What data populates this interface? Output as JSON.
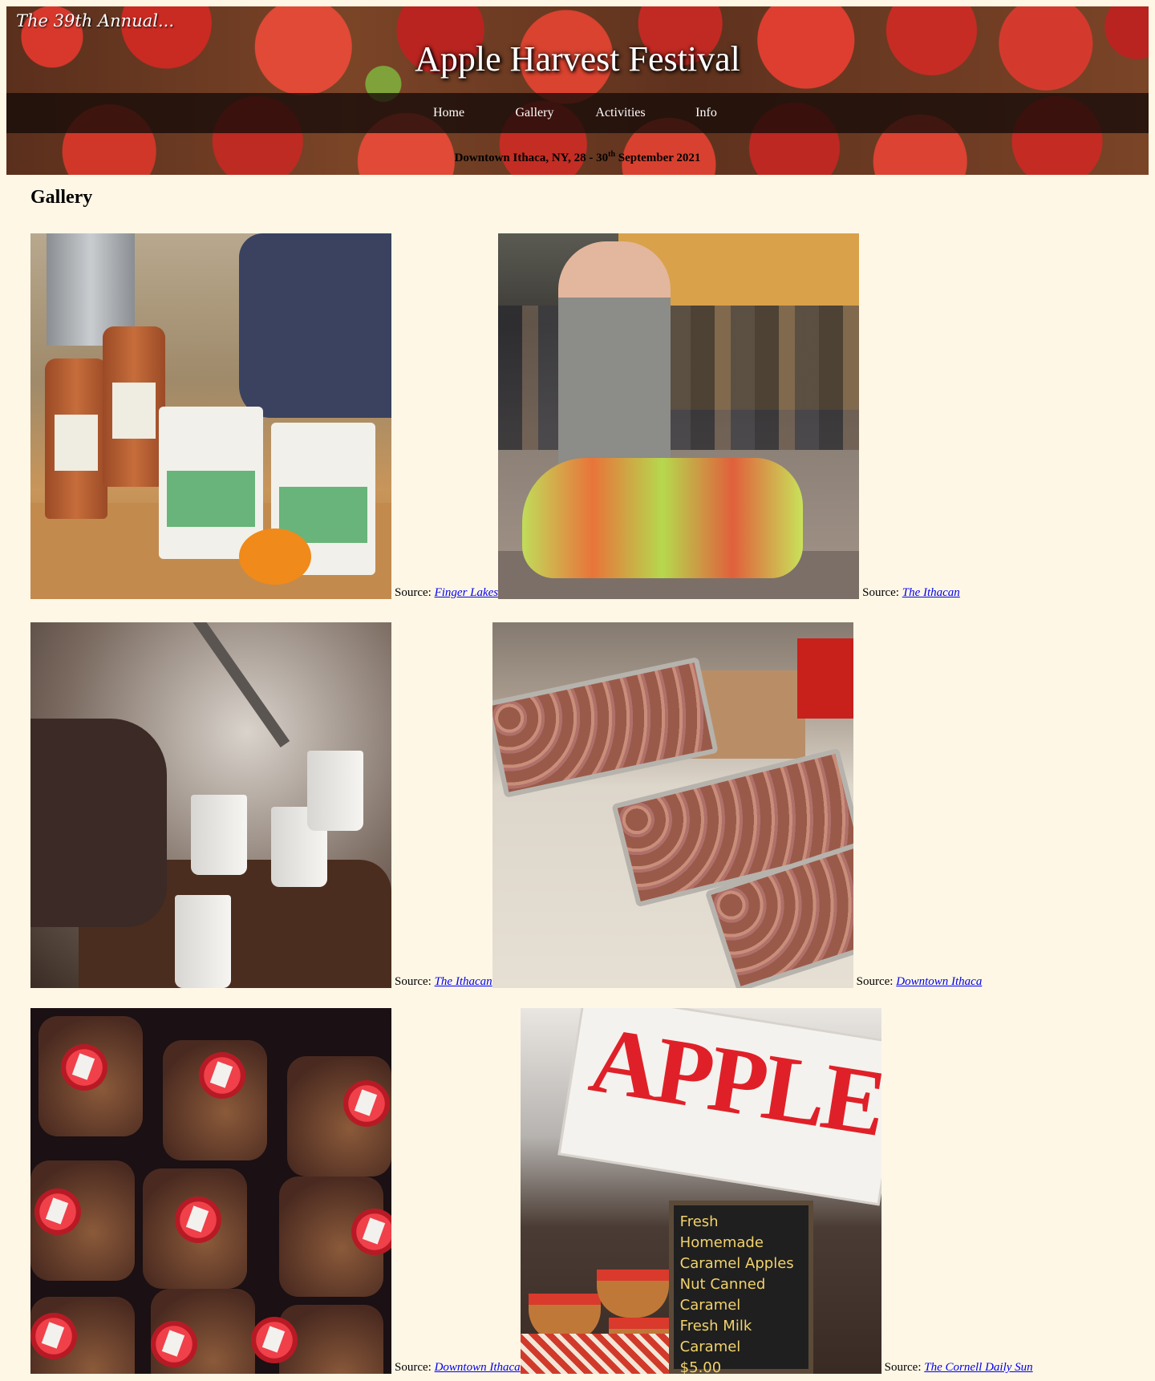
{
  "header": {
    "tagline": "The 39th Annual...",
    "title": "Apple Harvest Festival",
    "nav": [
      "Home",
      "Gallery",
      "Activities",
      "Info"
    ],
    "date_prefix": "Downtown Ithaca, NY, 28 - 30",
    "date_sup": "th",
    "date_suffix": " September 2021"
  },
  "gallery": {
    "heading": "Gallery",
    "source_label": "Source:",
    "items": [
      {
        "source": "Finger Lakes",
        "photo": "cider-jugs-and-apple-bags"
      },
      {
        "source": "The Ithacan",
        "photo": "woman-with-dyed-poodle"
      },
      {
        "source": "The Ithacan",
        "photo": "ladling-hot-cider"
      },
      {
        "source": "Downtown Ithaca",
        "photo": "trays-of-cider-donuts"
      },
      {
        "source": "Downtown Ithaca",
        "photo": "red-capped-cider-jugs"
      },
      {
        "source": "The Cornell Daily Sun",
        "photo": "apples-sign-stand"
      }
    ]
  },
  "photo_text": {
    "sign": "APPLES",
    "chalkboard": [
      "Fresh Homemade",
      "Caramel Apples",
      "Nut Canned Caramel",
      "Fresh Milk Caramel",
      "$5.00"
    ]
  },
  "colors": {
    "page_background": "#fff7e6",
    "link": "#0000ee",
    "nav_bar": "#140a08"
  }
}
